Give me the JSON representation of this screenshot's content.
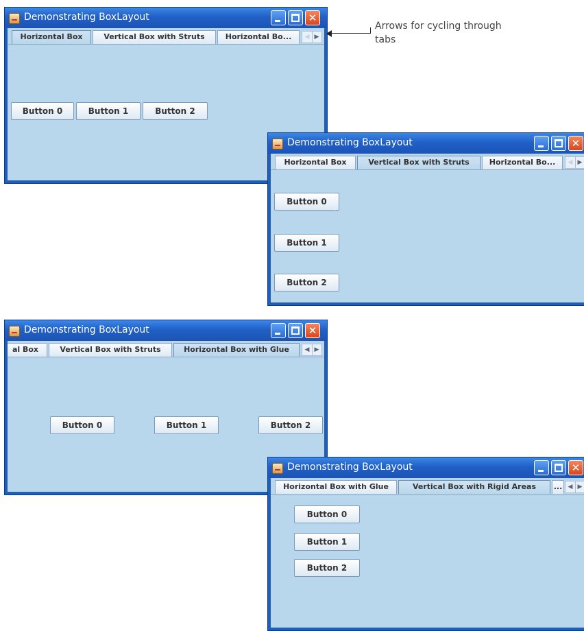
{
  "app_title": "Demonstrating BoxLayout",
  "callout": "Arrows for cycling through tabs",
  "windows": [
    {
      "tabs": [
        "Horizontal Box",
        "Vertical Box with Struts",
        "Horizontal Bo..."
      ],
      "selected_tab": "Horizontal Box",
      "buttons": [
        "Button 0",
        "Button 1",
        "Button 2"
      ]
    },
    {
      "tabs": [
        "Horizontal Box",
        "Vertical Box with Struts",
        "Horizontal Bo..."
      ],
      "selected_tab": "Vertical Box with Struts",
      "buttons": [
        "Button 0",
        "Button 1",
        "Button 2"
      ]
    },
    {
      "tabs": [
        "al Box",
        "Vertical Box with Struts",
        "Horizontal Box with Glue"
      ],
      "selected_tab": "Horizontal Box with Glue",
      "buttons": [
        "Button 0",
        "Button 1",
        "Button 2"
      ]
    },
    {
      "tabs": [
        "Horizontal Box with Glue",
        "Vertical Box with Rigid Areas",
        "..."
      ],
      "selected_tab": "Vertical Box with Rigid Areas",
      "buttons": [
        "Button 0",
        "Button 1",
        "Button 2"
      ]
    }
  ]
}
